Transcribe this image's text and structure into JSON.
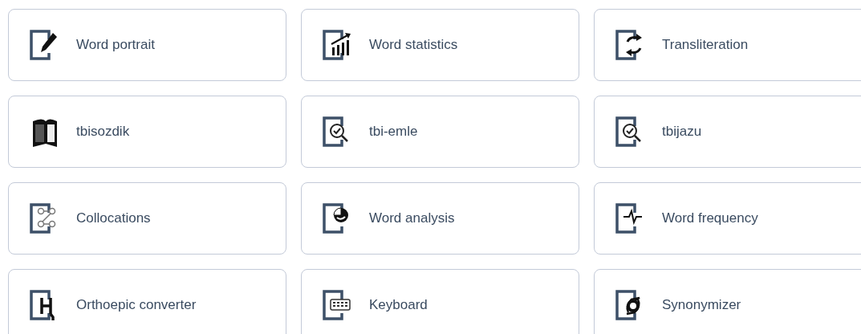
{
  "tools": [
    {
      "label": "Word portrait",
      "kind": "pencil"
    },
    {
      "label": "Word statistics",
      "kind": "chart"
    },
    {
      "label": "Transliteration",
      "kind": "arrows"
    },
    {
      "label": "tbisozdik",
      "kind": "book"
    },
    {
      "label": "tbi-emle",
      "kind": "check"
    },
    {
      "label": "tbijazu",
      "kind": "check"
    },
    {
      "label": "Collocations",
      "kind": "network"
    },
    {
      "label": "Word analysis",
      "kind": "pie"
    },
    {
      "label": "Word frequency",
      "kind": "pulse"
    },
    {
      "label": "Orthoepic converter",
      "kind": "letter"
    },
    {
      "label": "Keyboard",
      "kind": "keyboard"
    },
    {
      "label": "Synonymizer",
      "kind": "swirl"
    }
  ]
}
